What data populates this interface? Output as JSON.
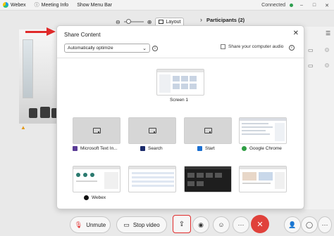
{
  "titlebar": {
    "app_name": "Webex",
    "meeting_info": "Meeting Info",
    "show_menu_bar": "Show Menu Bar",
    "status": "Connected",
    "minimize": "–",
    "maximize": "□",
    "close": "✕"
  },
  "view": {
    "zoom_out": "⊖",
    "zoom_in": "⊕",
    "layout_label": "Layout"
  },
  "participants": {
    "title": "Participants (2)"
  },
  "dialog": {
    "title": "Share Content",
    "close": "✕",
    "optimize_value": "Automatically optimize",
    "share_audio_label": "Share your computer audio",
    "info": "i",
    "screens": [
      {
        "label": "Screen 1"
      }
    ],
    "apps": [
      {
        "label": "Microsoft Text In...",
        "icon_color": "#5b3c96"
      },
      {
        "label": "Search",
        "icon_color": "#1b2b6b"
      },
      {
        "label": "Start",
        "icon_color": "#1a6fd1"
      },
      {
        "label": "Google Chrome",
        "icon_color": "#2f9e44"
      },
      {
        "label": "Webex",
        "icon_color": "#111111"
      }
    ]
  },
  "toolbar": {
    "unmute_label": "Unmute",
    "stop_video_label": "Stop video",
    "more": "···",
    "end_call": "✕"
  },
  "colors": {
    "accent_red": "#e02a2a",
    "end_call_red": "#e0413b",
    "status_green": "#2e9e4f",
    "warning_orange": "#e39a1b"
  },
  "icons": [
    "webex-logo-icon",
    "mic-icon",
    "video-camera-icon",
    "share-icon",
    "record-icon",
    "reaction-icon",
    "more-icon",
    "end-call-icon",
    "participants-icon",
    "chat-icon",
    "warning-icon",
    "info-icon",
    "close-icon",
    "chevron-down-icon",
    "layout-icon",
    "zoom-in-icon",
    "zoom-out-icon",
    "list-icon",
    "camera-status-icon"
  ]
}
